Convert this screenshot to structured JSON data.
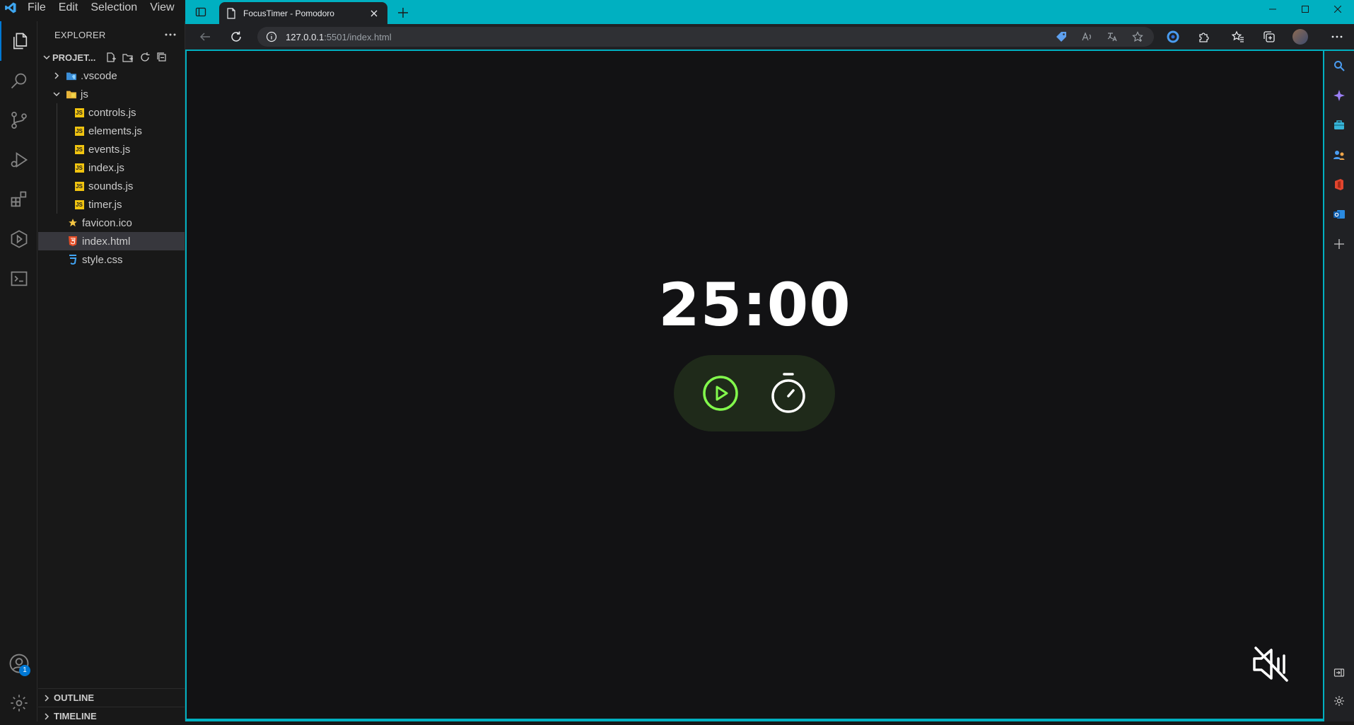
{
  "vscode": {
    "menu": [
      "File",
      "Edit",
      "Selection",
      "View"
    ],
    "explorer": {
      "title": "EXPLORER",
      "project": "PROJET...",
      "tree": [
        {
          "label": ".vscode",
          "type": "folder",
          "expanded": false,
          "depth": 0
        },
        {
          "label": "js",
          "type": "folder",
          "expanded": true,
          "depth": 0
        },
        {
          "label": "controls.js",
          "type": "js",
          "depth": 1
        },
        {
          "label": "elements.js",
          "type": "js",
          "depth": 1
        },
        {
          "label": "events.js",
          "type": "js",
          "depth": 1
        },
        {
          "label": "index.js",
          "type": "js",
          "depth": 1
        },
        {
          "label": "sounds.js",
          "type": "js",
          "depth": 1
        },
        {
          "label": "timer.js",
          "type": "js",
          "depth": 1
        },
        {
          "label": "favicon.ico",
          "type": "ico",
          "depth": 0
        },
        {
          "label": "index.html",
          "type": "html",
          "depth": 0,
          "selected": true
        },
        {
          "label": "style.css",
          "type": "css",
          "depth": 0
        }
      ],
      "outline": "OUTLINE",
      "timeline": "TIMELINE"
    },
    "accounts_badge": "1"
  },
  "browser": {
    "tab_title": "FocusTimer - Pomodoro",
    "url_host": "127.0.0.1",
    "url_path": ":5501/index.html"
  },
  "app": {
    "timer": "25:00",
    "colors": {
      "background": "#121214",
      "controls_bg": "#1f2a1a",
      "accent": "#82f94c"
    }
  }
}
